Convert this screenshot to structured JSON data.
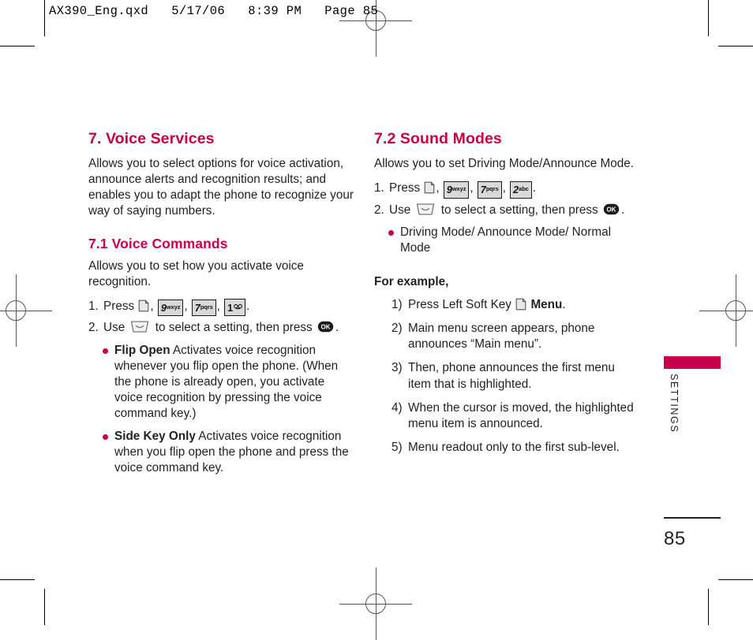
{
  "slug": "AX390_Eng.qxd   5/17/06   8:39 PM   Page 85",
  "theme": {
    "accent": "#c8004b",
    "text": "#231f20",
    "key_fill": "#d9d9d9",
    "key_border": "#1a1a1a"
  },
  "left_column": {
    "heading": "7. Voice Services",
    "intro": "Allows you to select options for voice activation, announce alerts and recognition results; and enables you to adapt the phone to recognize your way of saying numbers.",
    "subheading": "7.1 Voice Commands",
    "sub_intro": "Allows you to set how you activate voice recognition.",
    "step1": {
      "num": "1.",
      "verb": "Press",
      "keys": [
        "softkey-icon",
        "9wxyz",
        "7pqrs",
        "1"
      ],
      "trailing": "."
    },
    "step2": {
      "num": "2.",
      "verb": "Use",
      "nav": "nav-key-icon",
      "middle": "to select a setting, then press",
      "ok": "OK",
      "trailing": "."
    },
    "bullets": [
      {
        "lead": "Flip Open",
        "text": "Activates voice recognition whenever you flip open the phone. (When the phone is already open, you activate voice recognition by pressing the voice command key.)"
      },
      {
        "lead": "Side Key Only",
        "text": "Activates voice recognition when you flip open the phone and press the voice command key."
      }
    ]
  },
  "right_column": {
    "heading": "7.2 Sound Modes",
    "intro": "Allows you to set Driving Mode/Announce Mode.",
    "step1": {
      "num": "1.",
      "verb": "Press",
      "keys": [
        "softkey-icon",
        "9wxyz",
        "7pqrs",
        "2abc"
      ],
      "trailing": "."
    },
    "step2": {
      "num": "2.",
      "verb": "Use",
      "nav": "nav-key-icon",
      "middle": "to select a setting, then press",
      "ok": "OK",
      "trailing": "."
    },
    "bullets": [
      {
        "lead": "",
        "text": "Driving Mode/ Announce Mode/ Normal Mode"
      }
    ],
    "for_example": "For example,",
    "example_steps": [
      {
        "num": "1)",
        "pre": "Press Left Soft Key",
        "icon": "softkey-icon",
        "post": "Menu",
        "tail": "."
      },
      {
        "num": "2)",
        "pre": "Main menu screen appears, phone announces “Main menu”.",
        "icon": "",
        "post": "",
        "tail": ""
      },
      {
        "num": "3)",
        "pre": "Then, phone announces the first menu item that is highlighted.",
        "icon": "",
        "post": "",
        "tail": ""
      },
      {
        "num": "4)",
        "pre": "When the cursor is moved, the highlighted menu item is announced.",
        "icon": "",
        "post": "",
        "tail": ""
      },
      {
        "num": "5)",
        "pre": "Menu readout only to the first sub-level.",
        "icon": "",
        "post": "",
        "tail": ""
      }
    ]
  },
  "side_tab": {
    "label": "SETTINGS"
  },
  "folio": {
    "page_number": "85"
  },
  "keycaps": {
    "nine": {
      "digit": "9",
      "letters": "wxyz"
    },
    "seven": {
      "digit": "7",
      "letters": "pqrs"
    },
    "two": {
      "digit": "2",
      "letters": "abc"
    },
    "one": {
      "digit": "1",
      "letters": ""
    },
    "ok": {
      "digit": "OK",
      "letters": ""
    }
  }
}
